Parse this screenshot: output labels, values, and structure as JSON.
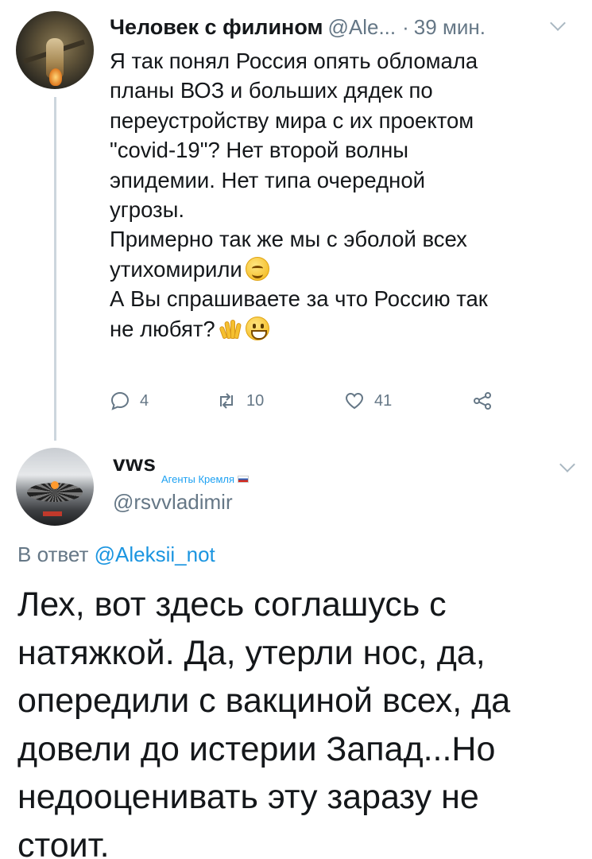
{
  "parent_tweet": {
    "author_name": "Человек с филином",
    "handle": "@Ale...",
    "separator": "·",
    "time": "39 мин.",
    "text_lines": [
      "Я так понял Россия опять обломала",
      "планы ВОЗ и больших дядек по",
      "переустройству мира с их проектом",
      "\"covid-19\"? Нет второй волны",
      "эпидемии. Нет типа очередной",
      "угрозы.",
      "Примерно так же мы с эболой всех",
      "утихомирили",
      "А Вы спрашиваете за что Россию так",
      "не любят?"
    ],
    "emojis": [
      "smiling-face",
      "waving-hand",
      "grinning-face"
    ],
    "actions": {
      "reply_count": "4",
      "retweet_count": "10",
      "like_count": "41"
    }
  },
  "reply_tweet": {
    "author_name": "vws",
    "badge_text": "Агенты Кремля",
    "badge_flag": "russian-flag",
    "handle": "@rsvvladimir",
    "reply_prefix": "В ответ",
    "reply_to_handle": "@Aleksii_not",
    "text_lines": [
      "Лех, вот здесь соглашусь с",
      "натяжкой. Да, утерли нос, да,",
      "опередили с вакциной всех, да",
      "довели до истерии Запад...Но",
      "недооценивать эту заразу не",
      "стоит."
    ]
  },
  "colors": {
    "text": "#14171a",
    "secondary": "#657786",
    "link": "#1b95e0",
    "thread_line": "#ccd6dd"
  }
}
